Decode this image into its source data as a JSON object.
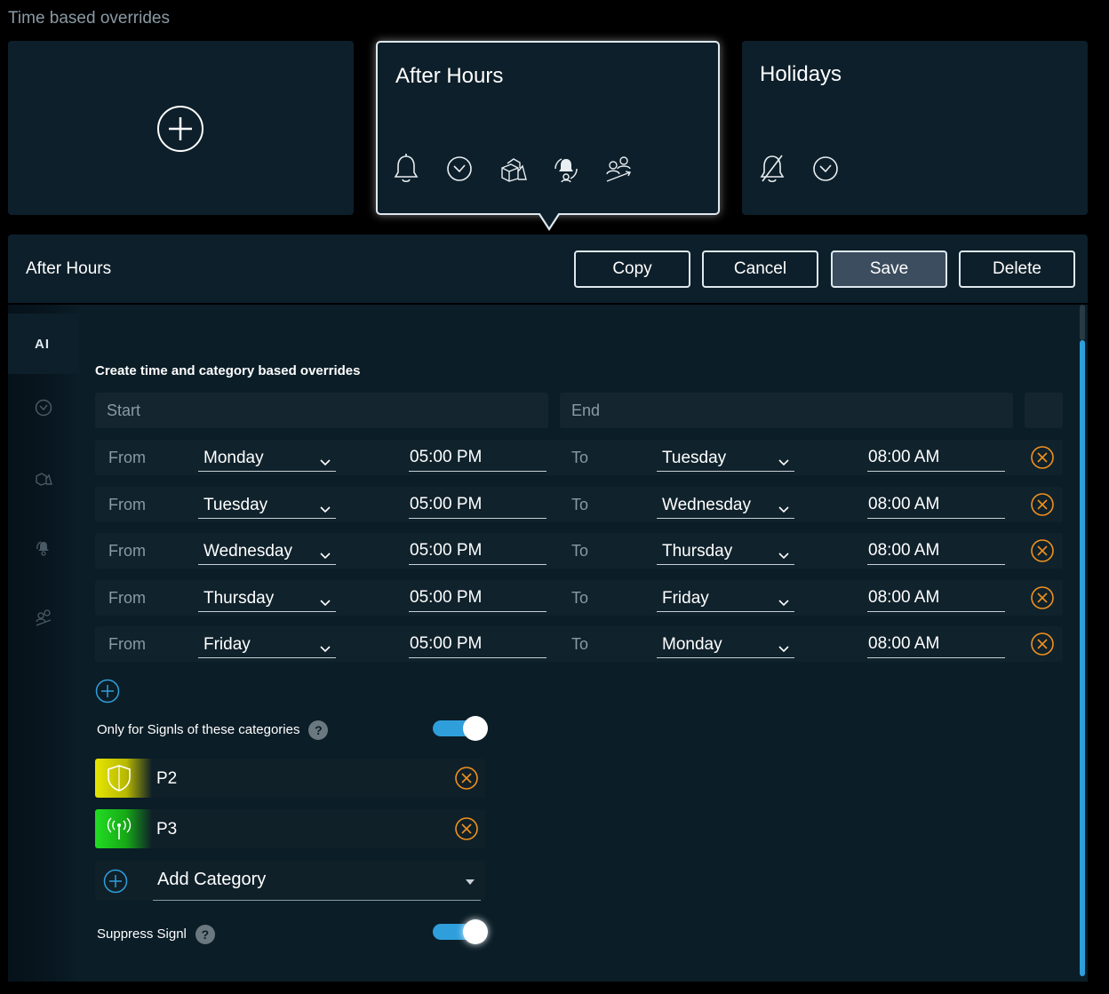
{
  "page": {
    "section_title": "Time based overrides"
  },
  "cards": {
    "add": {
      "icon": "plus-circle-icon"
    },
    "after_hours": {
      "title": "After Hours",
      "icons": [
        "bell-icon",
        "clock-icon",
        "boxes-icon",
        "bell-cycle-icon",
        "users-chart-icon"
      ]
    },
    "holidays": {
      "title": "Holidays",
      "icons": [
        "bell-off-icon",
        "clock-icon"
      ]
    }
  },
  "header": {
    "title": "After Hours",
    "buttons": {
      "copy": "Copy",
      "cancel": "Cancel",
      "save": "Save",
      "delete": "Delete"
    }
  },
  "sidebar": {
    "tabs": [
      {
        "label": "AI",
        "icon": "ai-icon",
        "active": true
      },
      {
        "icon": "clock-icon"
      },
      {
        "icon": "boxes-icon"
      },
      {
        "icon": "bell-cycle-icon"
      },
      {
        "icon": "users-icon"
      }
    ]
  },
  "overrides": {
    "subtitle": "Create time and category based overrides",
    "col_start": "Start",
    "col_end": "End",
    "from_label": "From",
    "to_label": "To",
    "rows": [
      {
        "from_day": "Monday",
        "from_time": "05:00 PM",
        "to_day": "Tuesday",
        "to_time": "08:00 AM"
      },
      {
        "from_day": "Tuesday",
        "from_time": "05:00 PM",
        "to_day": "Wednesday",
        "to_time": "08:00 AM"
      },
      {
        "from_day": "Wednesday",
        "from_time": "05:00 PM",
        "to_day": "Thursday",
        "to_time": "08:00 AM"
      },
      {
        "from_day": "Thursday",
        "from_time": "05:00 PM",
        "to_day": "Friday",
        "to_time": "08:00 AM"
      },
      {
        "from_day": "Friday",
        "from_time": "05:00 PM",
        "to_day": "Monday",
        "to_time": "08:00 AM"
      }
    ]
  },
  "categories": {
    "toggle_label": "Only for Signls of these categories",
    "toggle_on": true,
    "items": [
      {
        "name": "P2",
        "icon": "shield-icon",
        "color": "#e0e000"
      },
      {
        "name": "P3",
        "icon": "broadcast-icon",
        "color": "#22dd22"
      }
    ],
    "add_label": "Add Category"
  },
  "suppress": {
    "label": "Suppress Signl",
    "toggle_on": true
  },
  "colors": {
    "accent": "#2f9fdc",
    "remove": "#f0921e",
    "panel": "#0b1d27"
  }
}
